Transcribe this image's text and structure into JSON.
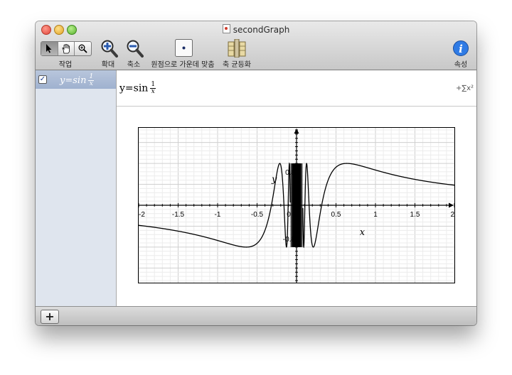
{
  "window": {
    "title": "secondGraph"
  },
  "toolbar": {
    "tools_label": "작업",
    "zoom_in_label": "확대",
    "zoom_out_label": "축소",
    "center_origin_label": "원점으로 가운데 맞춤",
    "equalize_axes_label": "축 균등화",
    "info_label": "속성"
  },
  "sidebar": {
    "items": [
      {
        "checked": true,
        "check_mark": "✓",
        "equation": "y=sin",
        "frac_num": "1",
        "frac_den": "x"
      }
    ],
    "add_button_label": "+"
  },
  "equation_bar": {
    "lhs": "y=sin",
    "frac_num": "1",
    "frac_den": "x",
    "sigma_label": "+∑x²"
  },
  "chart_data": {
    "type": "line",
    "function": "y=sin(1/x)",
    "xlabel": "x",
    "ylabel": "y",
    "xlim": [
      -2,
      2
    ],
    "ylim": [
      -1.85,
      1.85
    ],
    "x_ticks": [
      "-2",
      "-1.5",
      "-1",
      "-0.5",
      "0",
      "0.5",
      "1",
      "1.5",
      "2"
    ],
    "y_ticks": [
      "0.8",
      "-0.8"
    ],
    "grid": true,
    "series": [
      {
        "color": "#000000",
        "x": [
          -2,
          -1.5,
          -1,
          -0.75,
          -0.6366,
          -0.5,
          -0.3,
          -0.2122,
          -0.15,
          -0.1,
          0,
          0.1,
          0.15,
          0.2122,
          0.3,
          0.5,
          0.6366,
          0.75,
          1,
          1.5,
          2
        ],
        "y": [
          -0.479,
          -0.618,
          -0.841,
          -0.972,
          -1,
          -0.909,
          -0.19,
          1,
          0.375,
          0.544,
          0,
          -0.544,
          -0.375,
          -1,
          0.19,
          0.909,
          1,
          0.972,
          0.841,
          0.618,
          0.479
        ]
      }
    ]
  }
}
